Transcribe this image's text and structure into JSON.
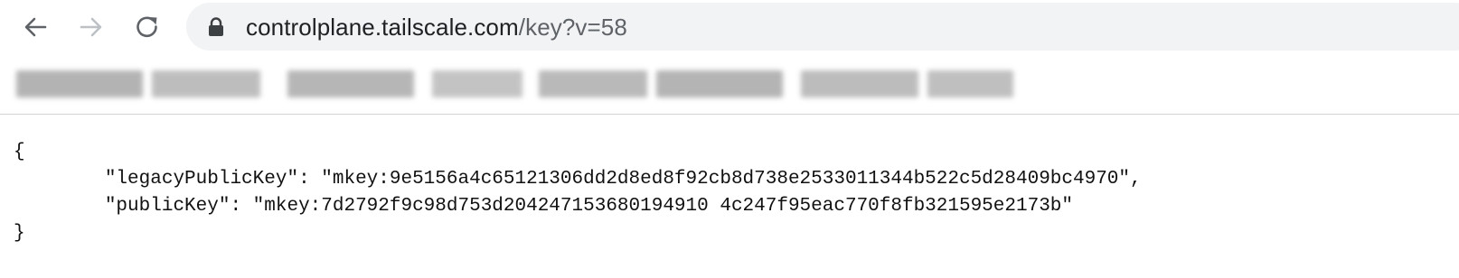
{
  "browser": {
    "back_icon": "arrow-left-icon",
    "forward_icon": "arrow-right-icon",
    "reload_icon": "reload-icon",
    "lock_icon": "lock-icon",
    "url_host": "controlplane.tailscale.com",
    "url_path": "/key?v=58",
    "colors": {
      "omnibox_bg": "#f1f3f4",
      "icon": "#5f6368",
      "icon_disabled": "#bdc1c6"
    }
  },
  "bookmarks_bar": {
    "obscured": true
  },
  "json_view": {
    "open_brace": "{",
    "close_brace": "}",
    "line1": "\t\"legacyPublicKey\": \"mkey:9e5156a4c65121306dd2d8ed8f92cb8d738e2533011344b522c5d28409bc4970\",",
    "line2": "\t\"publicKey\": \"mkey:7d2792f9c98d753d204247153680194910 4c247f95eac770f8fb321595e2173b\""
  }
}
